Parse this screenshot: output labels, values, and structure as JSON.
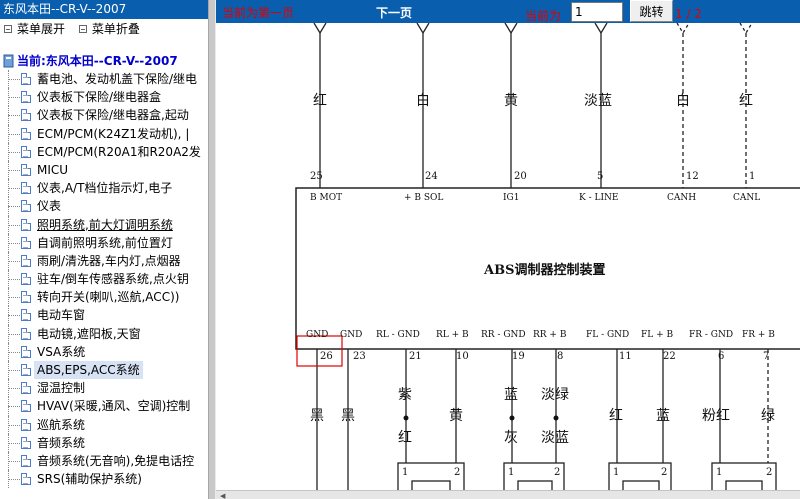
{
  "left": {
    "title": "东风本田--CR-V--2007",
    "menu": {
      "expand": "菜单展开",
      "collapse": "菜单折叠"
    },
    "tree": {
      "root": "当前:东风本田--CR-V--2007",
      "items": [
        "蓄电池、发动机盖下保险/继电",
        "仪表板下保险/继电器盒",
        "仪表板下保险/继电器盒,起动",
        "ECM/PCM(K24Z1发动机), |",
        "ECM/PCM(R20A1和R20A2发",
        "MICU",
        "仪表,A/T档位指示灯,电子",
        "仪表",
        "照明系统,前大灯调明系统",
        "自调前照明系统,前位置灯",
        "雨刷/清洗器,车内灯,点烟器",
        "驻车/倒车传感器系统,点火钥",
        "转向开关(喇叭,巡航,ACC))",
        "电动车窗",
        "电动镜,遮阳板,天窗",
        "VSA系统",
        "ABS,EPS,ACC系统",
        "湿温控制",
        "HVAV(采暖,通风、空调)控制",
        "巡航系统",
        "音频系统",
        "音频系统(无音响),免提电话控",
        "SRS(辅助保护系统)"
      ]
    }
  },
  "toolbar": {
    "first_page": "当前为第一页",
    "next_page": "下一页",
    "current_label": "当前为",
    "page_value": "1",
    "jump": "跳转",
    "page_count": "1 / 2"
  },
  "diagram": {
    "module_title": "ABS调制器控制装置",
    "top_wires": [
      {
        "color": "红",
        "pin": "25",
        "signal": "B MOT"
      },
      {
        "color": "白",
        "pin": "24",
        "signal": "+ B SOL"
      },
      {
        "color": "黄",
        "pin": "20",
        "signal": "IG1"
      },
      {
        "color": "淡蓝",
        "pin": "5",
        "signal": "K - LINE"
      },
      {
        "color": "白",
        "pin": "12",
        "signal": "CANH"
      },
      {
        "color": "红",
        "pin": "1",
        "signal": "CANL"
      }
    ],
    "bottom_signals": [
      "GND",
      "GND",
      "RL - GND",
      "RL + B",
      "RR - GND",
      "RR + B",
      "FL - GND",
      "FL + B",
      "FR - GND",
      "FR + B"
    ],
    "bottom_pins": [
      "26",
      "23",
      "21",
      "10",
      "19",
      "8",
      "11",
      "22",
      "6",
      "7"
    ],
    "bottom_colors_upper": [
      "黑",
      "黑",
      "紫",
      "黄",
      "蓝",
      "淡绿",
      "红",
      "蓝",
      "粉红",
      "绿"
    ],
    "bottom_colors_lower": [
      "红",
      "灰",
      "淡蓝"
    ],
    "connector_pins": [
      "1",
      "2",
      "1",
      "2",
      "1",
      "2",
      "1",
      "2"
    ]
  }
}
